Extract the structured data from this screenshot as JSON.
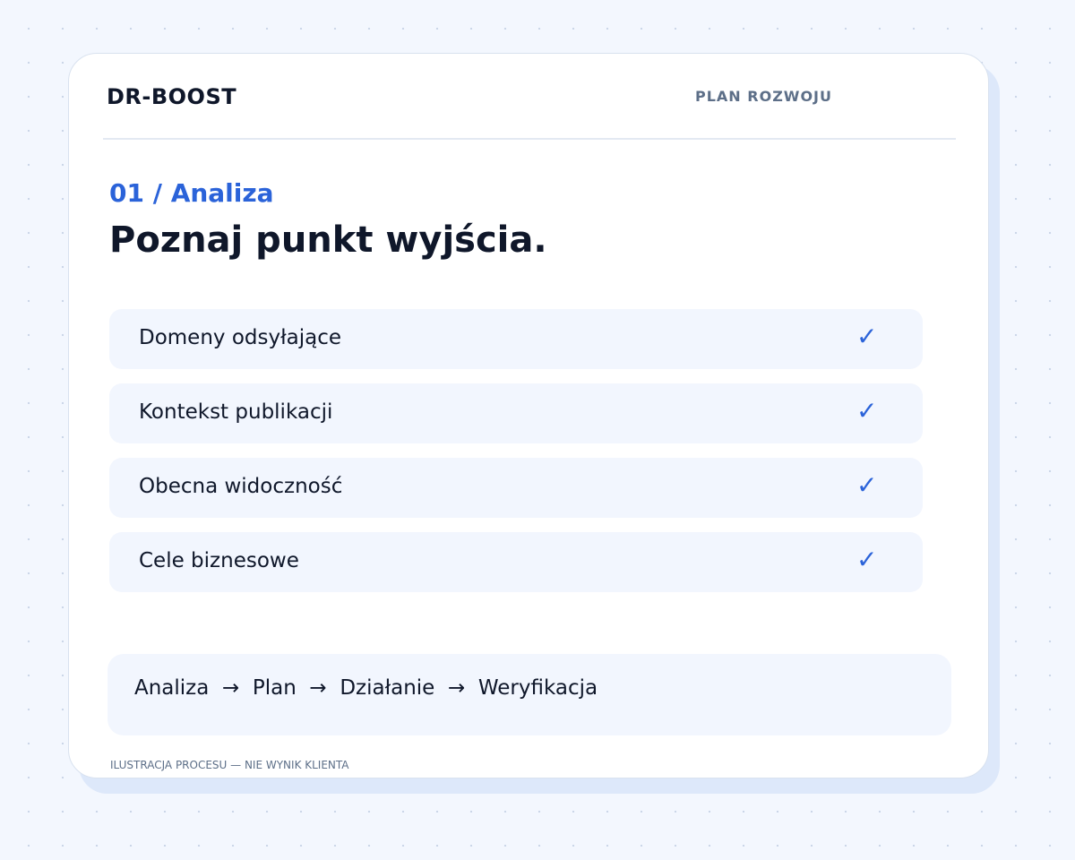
{
  "header": {
    "brand": "DR-BOOST",
    "section_label": "PLAN ROZWOJU"
  },
  "step": {
    "label": "01 / Analiza",
    "headline": "Poznaj punkt wyjścia."
  },
  "checklist": {
    "items": [
      {
        "label": "Domeny odsyłające",
        "check": "✓"
      },
      {
        "label": "Kontekst publikacji",
        "check": "✓"
      },
      {
        "label": "Obecna widoczność",
        "check": "✓"
      },
      {
        "label": "Cele biznesowe",
        "check": "✓"
      }
    ]
  },
  "flow": {
    "text": "Analiza  →  Plan  →  Działanie  →  Weryfikacja"
  },
  "footer": {
    "note": "ILUSTRACJA PROCESU — NIE WYNIK KLIENTA"
  },
  "colors": {
    "accent": "#2b63d9",
    "text_dark": "#0f172a",
    "muted": "#5d6f88",
    "item_background": "#f2f6fe",
    "page_background": "#f3f7fe"
  }
}
